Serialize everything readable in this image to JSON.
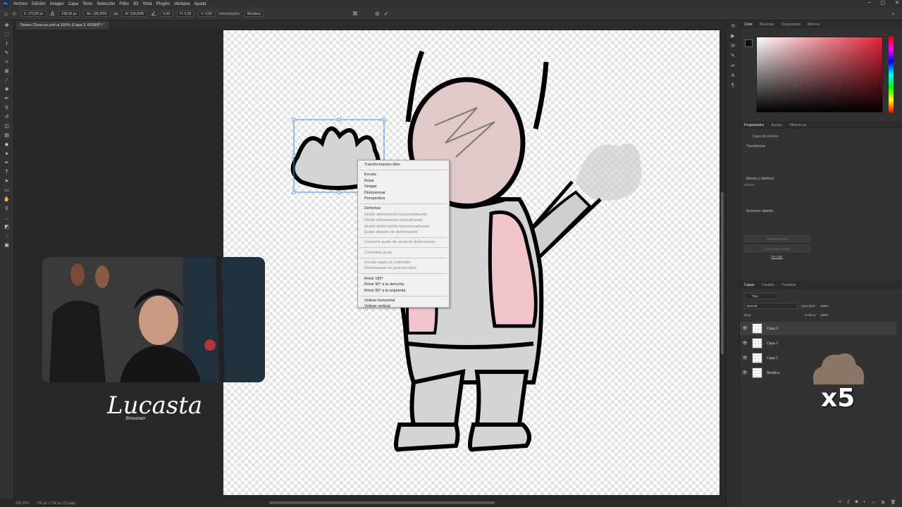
{
  "app": {
    "logo": "Ps",
    "menu": [
      "Archivo",
      "Edición",
      "Imagen",
      "Capa",
      "Texto",
      "Selección",
      "Filtro",
      "3D",
      "Vista",
      "Plugins",
      "Ventana",
      "Ayuda"
    ]
  },
  "options_bar": {
    "x_value": "X: 175,00 px",
    "y_value": "238,50 px",
    "w_value": "An: 100,00%",
    "h_value": "Al: 100,00%",
    "angle": "0,00",
    "h_skew": "H: 0,00",
    "v_skew": "V: 0,00",
    "interpolation_label": "Interpolación:",
    "interpolation_value": "Bicúbica"
  },
  "document": {
    "tab_title": "Dedos Chuecos.psd al 193% (Capa 3, RGB/8*) *"
  },
  "status": {
    "zoom": "193,26%",
    "size": "736 px x 736 px (72 ppp)"
  },
  "context_menu": {
    "items": [
      {
        "label": "Transformación libre",
        "disabled": false
      },
      {
        "sep": true
      },
      {
        "label": "Escala",
        "disabled": false
      },
      {
        "label": "Rotar",
        "disabled": false
      },
      {
        "label": "Sesgar",
        "disabled": false
      },
      {
        "label": "Distorsionar",
        "disabled": false
      },
      {
        "label": "Perspectiva",
        "disabled": false
      },
      {
        "sep": true
      },
      {
        "label": "Deformar",
        "disabled": false
      },
      {
        "label": "Dividir deformación horizontalmente",
        "disabled": true
      },
      {
        "label": "Dividir deformación verticalmente",
        "disabled": true
      },
      {
        "label": "Dividir deformación transversalmente",
        "disabled": true
      },
      {
        "label": "Quitar división de deformación",
        "disabled": true
      },
      {
        "sep": true
      },
      {
        "label": "Convertir punto de ancla de deformación",
        "disabled": true
      },
      {
        "sep": true
      },
      {
        "label": "Conmutar guías",
        "disabled": true
      },
      {
        "sep": true
      },
      {
        "label": "Escala según el contenido",
        "disabled": true
      },
      {
        "label": "Deformación de posición libre",
        "disabled": true
      },
      {
        "sep": true
      },
      {
        "label": "Rotar 180°",
        "disabled": false
      },
      {
        "label": "Rotar 90° a la derecha",
        "disabled": false
      },
      {
        "label": "Rotar 90° a la izquierda",
        "disabled": false
      },
      {
        "sep": true
      },
      {
        "label": "Voltear horizontal",
        "disabled": false
      },
      {
        "label": "Voltear vertical",
        "disabled": false
      }
    ]
  },
  "color_panel": {
    "tabs": [
      "Color",
      "Muestras",
      "Degradados",
      "Motivos"
    ],
    "fg_color": "#111111",
    "bg_color": "#ffffff",
    "hue_color": "#e32336"
  },
  "properties_panel": {
    "tabs": [
      "Propiedades",
      "Ajustes",
      "Bibliotecas"
    ],
    "layer_type": "Capa de píxeles",
    "transform_title": "Transformar",
    "align_title": "Alinear y distribuir",
    "align_label": "Alinear:",
    "quick_actions_title": "Acciones rápidas",
    "remove_bg": "Eliminar fondo",
    "select_subject": "Seleccionar sujeto",
    "more": "Ver más"
  },
  "layers_panel": {
    "tabs": [
      "Capas",
      "Canales",
      "Trazados"
    ],
    "filter": "Tipo",
    "blend_mode": "Normal",
    "opacity_label": "Opacidad:",
    "opacity_value": "100%",
    "lock_label": "Bloq:",
    "fill_label": "Relleno:",
    "fill_value": "100%",
    "layers": [
      {
        "name": "Capa 3",
        "selected": true
      },
      {
        "name": "Capa 2",
        "selected": false
      },
      {
        "name": "Capa 1",
        "selected": false
      },
      {
        "name": "Metálico",
        "selected": false
      }
    ]
  },
  "overlay": {
    "streamer_name": "Lucasta",
    "streamer_sub": "Streamer",
    "multiplier": "x5"
  }
}
